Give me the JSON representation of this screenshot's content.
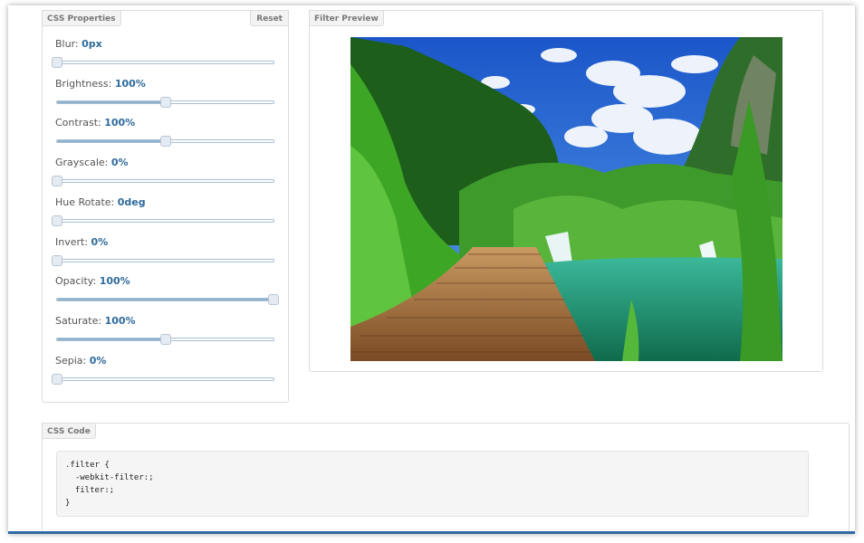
{
  "panels": {
    "properties": {
      "title": "CSS Properties",
      "reset_label": "Reset"
    },
    "preview": {
      "title": "Filter Preview"
    },
    "code": {
      "title": "CSS Code"
    }
  },
  "properties": [
    {
      "label": "Blur:",
      "value": "0px",
      "level": 0
    },
    {
      "label": "Brightness:",
      "value": "100%",
      "level": 0.5
    },
    {
      "label": "Contrast:",
      "value": "100%",
      "level": 0.5
    },
    {
      "label": "Grayscale:",
      "value": "0%",
      "level": 0
    },
    {
      "label": "Hue Rotate:",
      "value": "0deg",
      "level": 0
    },
    {
      "label": "Invert:",
      "value": "0%",
      "level": 0
    },
    {
      "label": "Opacity:",
      "value": "100%",
      "level": 1
    },
    {
      "label": "Saturate:",
      "value": "100%",
      "level": 0.5
    },
    {
      "label": "Sepia:",
      "value": "0%",
      "level": 0
    }
  ],
  "code_lines": [
    ".filter {",
    "  -webkit-filter:;",
    "  filter:;",
    "}"
  ],
  "colors": {
    "accent": "#2e6a9b",
    "slider_fill": "#8fb3cf",
    "frame_bar": "#2f6aa3"
  }
}
